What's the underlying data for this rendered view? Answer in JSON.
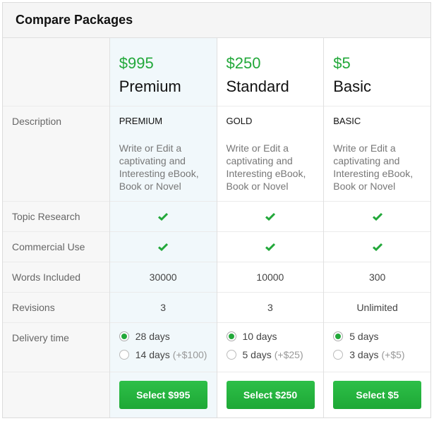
{
  "title": "Compare Packages",
  "row_labels": {
    "description": "Description",
    "topic_research": "Topic Research",
    "commercial_use": "Commercial Use",
    "words_included": "Words Included",
    "revisions": "Revisions",
    "delivery_time": "Delivery time"
  },
  "colors": {
    "accent": "#22a83a",
    "featured_bg": "#f1f8fb"
  },
  "packages": [
    {
      "price": "$995",
      "name": "Premium",
      "tier": "PREMIUM",
      "description": "Write or Edit a captivating and Interesting eBook, Book or Novel",
      "topic_research": true,
      "commercial_use": true,
      "words": "30000",
      "revisions": "3",
      "delivery_options": [
        {
          "label": "28 days",
          "extra": "",
          "selected": true
        },
        {
          "label": "14 days",
          "extra": "(+$100)",
          "selected": false
        }
      ],
      "button": "Select $995",
      "featured": true
    },
    {
      "price": "$250",
      "name": "Standard",
      "tier": "GOLD",
      "description": "Write or Edit a captivating and Interesting eBook, Book or Novel",
      "topic_research": true,
      "commercial_use": true,
      "words": "10000",
      "revisions": "3",
      "delivery_options": [
        {
          "label": "10 days",
          "extra": "",
          "selected": true
        },
        {
          "label": "5 days",
          "extra": "(+$25)",
          "selected": false
        }
      ],
      "button": "Select $250",
      "featured": false
    },
    {
      "price": "$5",
      "name": "Basic",
      "tier": "BASIC",
      "description": "Write or Edit a captivating and Interesting eBook, Book or Novel",
      "topic_research": true,
      "commercial_use": true,
      "words": "300",
      "revisions": "Unlimited",
      "delivery_options": [
        {
          "label": "5 days",
          "extra": "",
          "selected": true
        },
        {
          "label": "3 days",
          "extra": "(+$5)",
          "selected": false
        }
      ],
      "button": "Select $5",
      "featured": false
    }
  ]
}
